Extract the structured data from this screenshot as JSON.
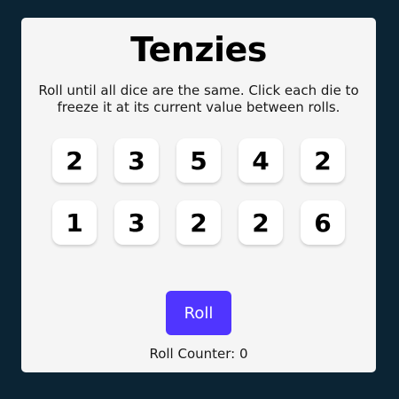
{
  "title": "Tenzies",
  "instructions": "Roll until all dice are the same. Click each die to freeze it at its current value between rolls.",
  "dice": [
    {
      "value": "2"
    },
    {
      "value": "3"
    },
    {
      "value": "5"
    },
    {
      "value": "4"
    },
    {
      "value": "2"
    },
    {
      "value": "1"
    },
    {
      "value": "3"
    },
    {
      "value": "2"
    },
    {
      "value": "2"
    },
    {
      "value": "6"
    }
  ],
  "roll_button": {
    "label": "Roll"
  },
  "counter": {
    "text": "Roll Counter: 0"
  },
  "colors": {
    "background": "#0b2434",
    "card": "#f5f5f5",
    "accent": "#5035ff"
  }
}
